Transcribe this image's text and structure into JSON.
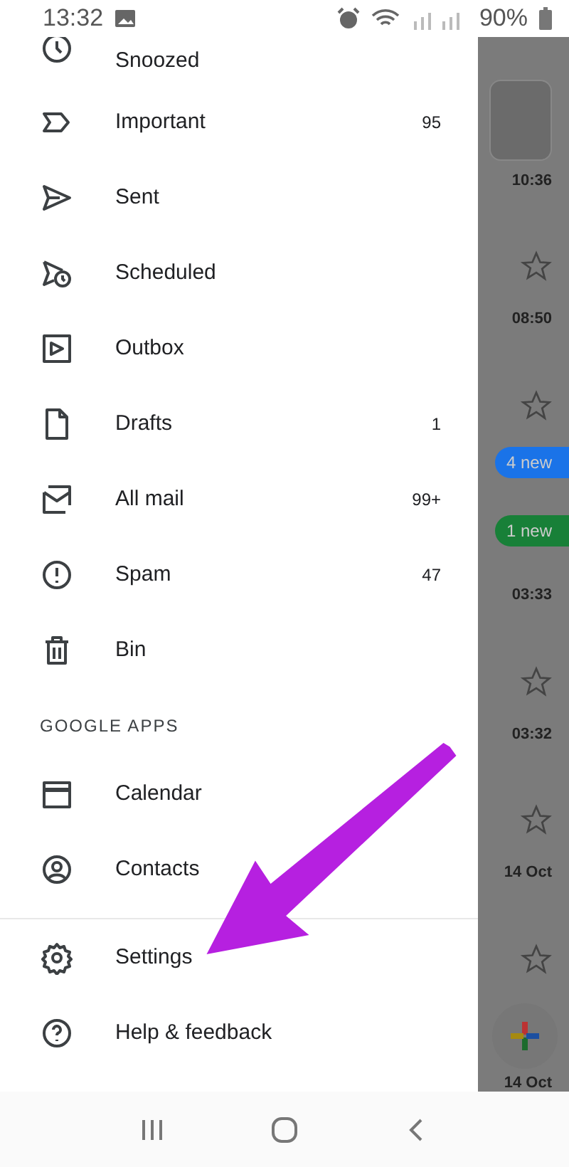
{
  "status_bar": {
    "time": "13:32",
    "battery": "90%"
  },
  "drawer": {
    "items": [
      {
        "label": "Snoozed"
      },
      {
        "label": "Important",
        "count": "95"
      },
      {
        "label": "Sent"
      },
      {
        "label": "Scheduled"
      },
      {
        "label": "Outbox"
      },
      {
        "label": "Drafts",
        "count": "1"
      },
      {
        "label": "All mail",
        "count": "99+"
      },
      {
        "label": "Spam",
        "count": "47"
      },
      {
        "label": "Bin"
      }
    ],
    "section_title": "GOOGLE APPS",
    "apps": [
      {
        "label": "Calendar"
      },
      {
        "label": "Contacts"
      }
    ],
    "footer": [
      {
        "label": "Settings"
      },
      {
        "label": "Help & feedback"
      }
    ]
  },
  "background_list": [
    {
      "kind": "avatar"
    },
    {
      "kind": "mail",
      "time": "10:36"
    },
    {
      "kind": "mail",
      "time": "08:50"
    },
    {
      "kind": "badge",
      "text": "4 new",
      "color": "#1a73e8"
    },
    {
      "kind": "badge",
      "text": "1 new",
      "color": "#188038"
    },
    {
      "kind": "mail",
      "time": "03:33"
    },
    {
      "kind": "mail",
      "time": "03:32"
    },
    {
      "kind": "mail",
      "time": "14 Oct"
    },
    {
      "kind": "fab",
      "time": "14 Oct"
    }
  ]
}
